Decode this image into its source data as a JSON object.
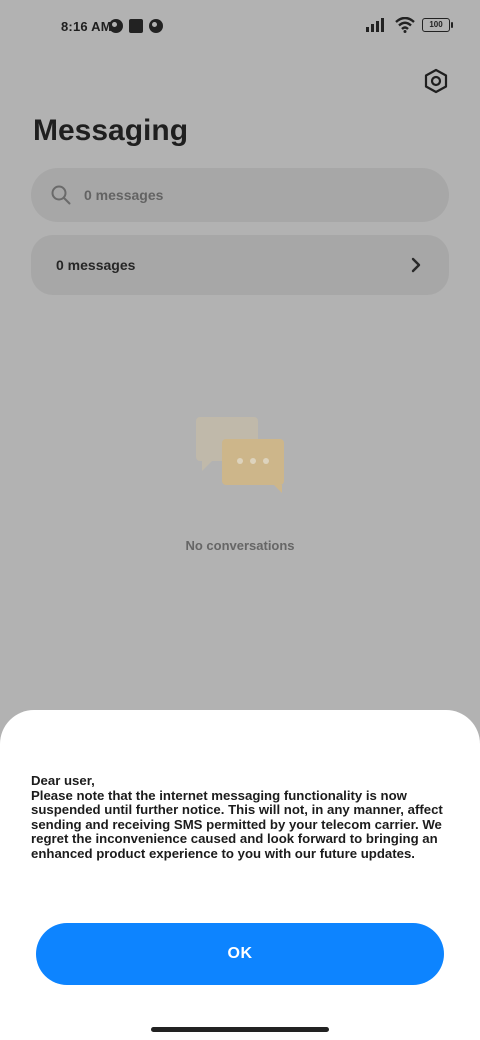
{
  "status_bar": {
    "time": "8:16 AM",
    "battery": "100"
  },
  "header": {
    "title": "Messaging",
    "settings_icon": "settings-hexagon-icon"
  },
  "search": {
    "placeholder": "0 messages"
  },
  "messages_row": {
    "label": "0 messages"
  },
  "empty_state": {
    "text": "No conversations"
  },
  "dialog": {
    "lines": [
      "Dear user,",
      "Please note that the internet messaging functionality is now suspended until further notice. This will not, in any manner, affect sending and receiving SMS permitted by your telecom carrier. We regret the inconvenience caused and look forward to bringing an enhanced product experience to you with our future updates."
    ],
    "ok_label": "OK"
  },
  "colors": {
    "accent": "#0d84ff",
    "scrim": "#b2b2b2"
  }
}
